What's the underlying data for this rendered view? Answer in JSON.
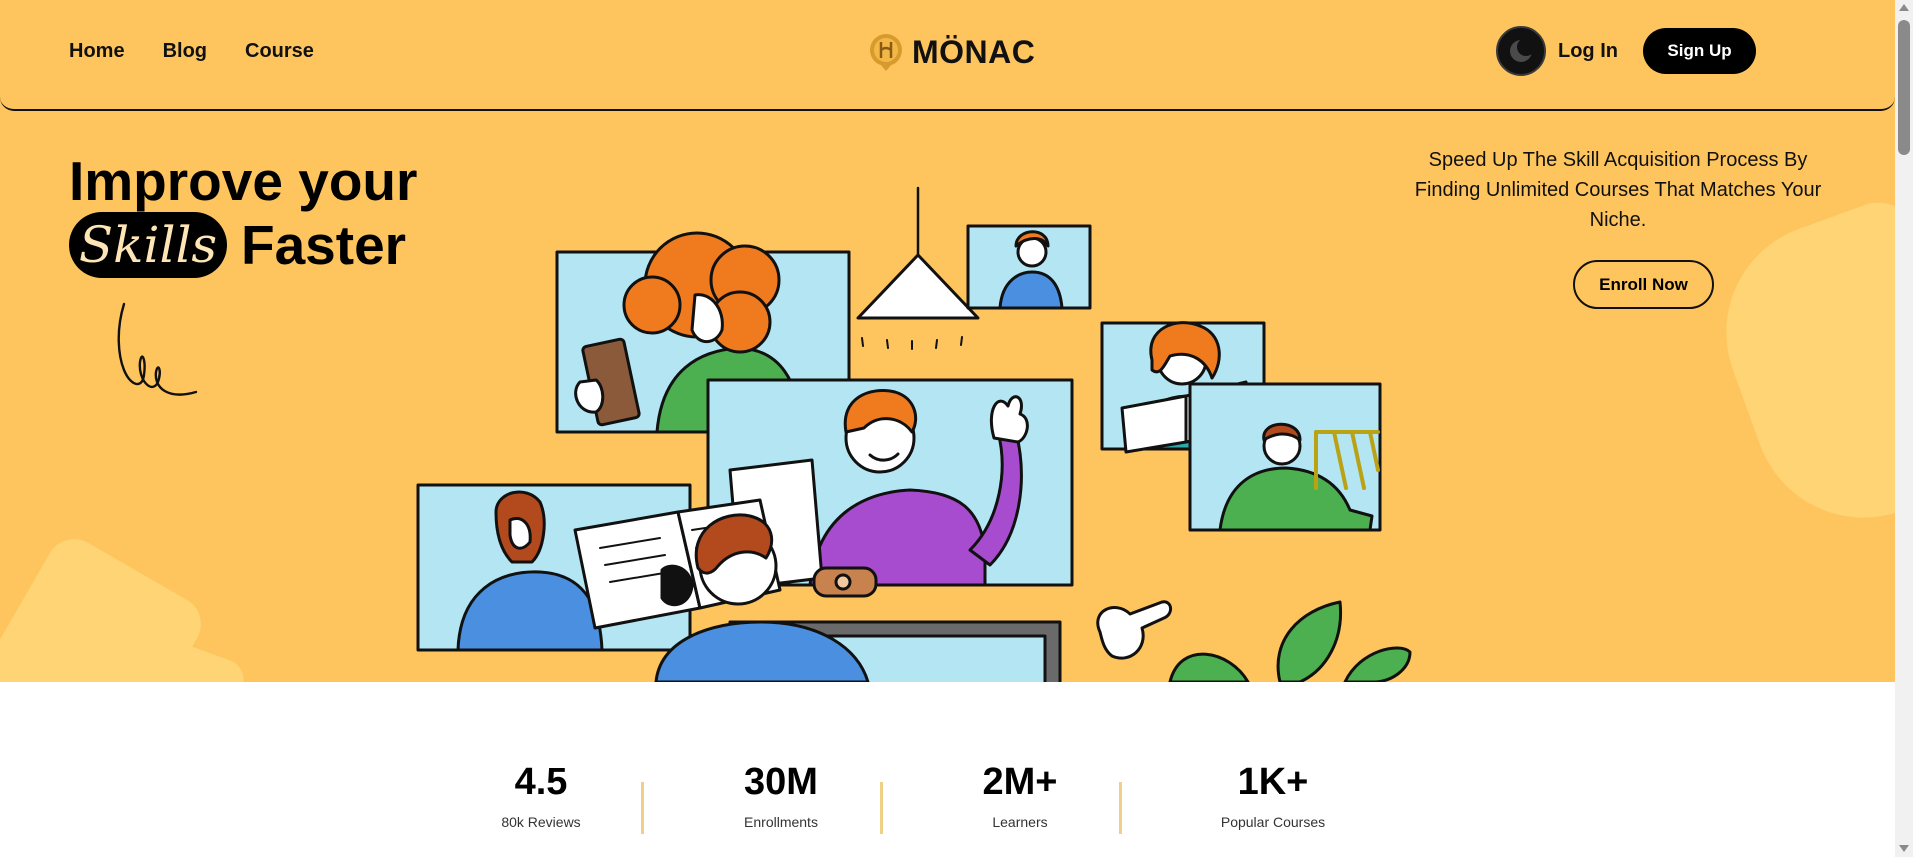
{
  "nav": {
    "links": [
      "Home",
      "Blog",
      "Course"
    ],
    "logo_text": "MÖNAC",
    "logo_icon": "monac-coin-logo",
    "theme_icon": "moon-icon",
    "login_label": "Log In",
    "signup_label": "Sign Up"
  },
  "hero": {
    "heading_line1": "Improve your",
    "heading_highlight": "Skills",
    "heading_line2_rest": "Faster",
    "tagline": "Speed Up The Skill Acquisition Process By Finding Unlimited Courses That Matches Your Niche.",
    "cta_label": "Enroll Now"
  },
  "stats": [
    {
      "value": "4.5",
      "label": "80k Reviews"
    },
    {
      "value": "30M",
      "label": "Enrollments"
    },
    {
      "value": "2M+",
      "label": "Learners"
    },
    {
      "value": "1K+",
      "label": "Popular Courses"
    }
  ],
  "colors": {
    "hero_background": "#fec55e",
    "accent_blob": "#ffd474",
    "button_dark": "#000000",
    "divider": "#f0cf86"
  }
}
